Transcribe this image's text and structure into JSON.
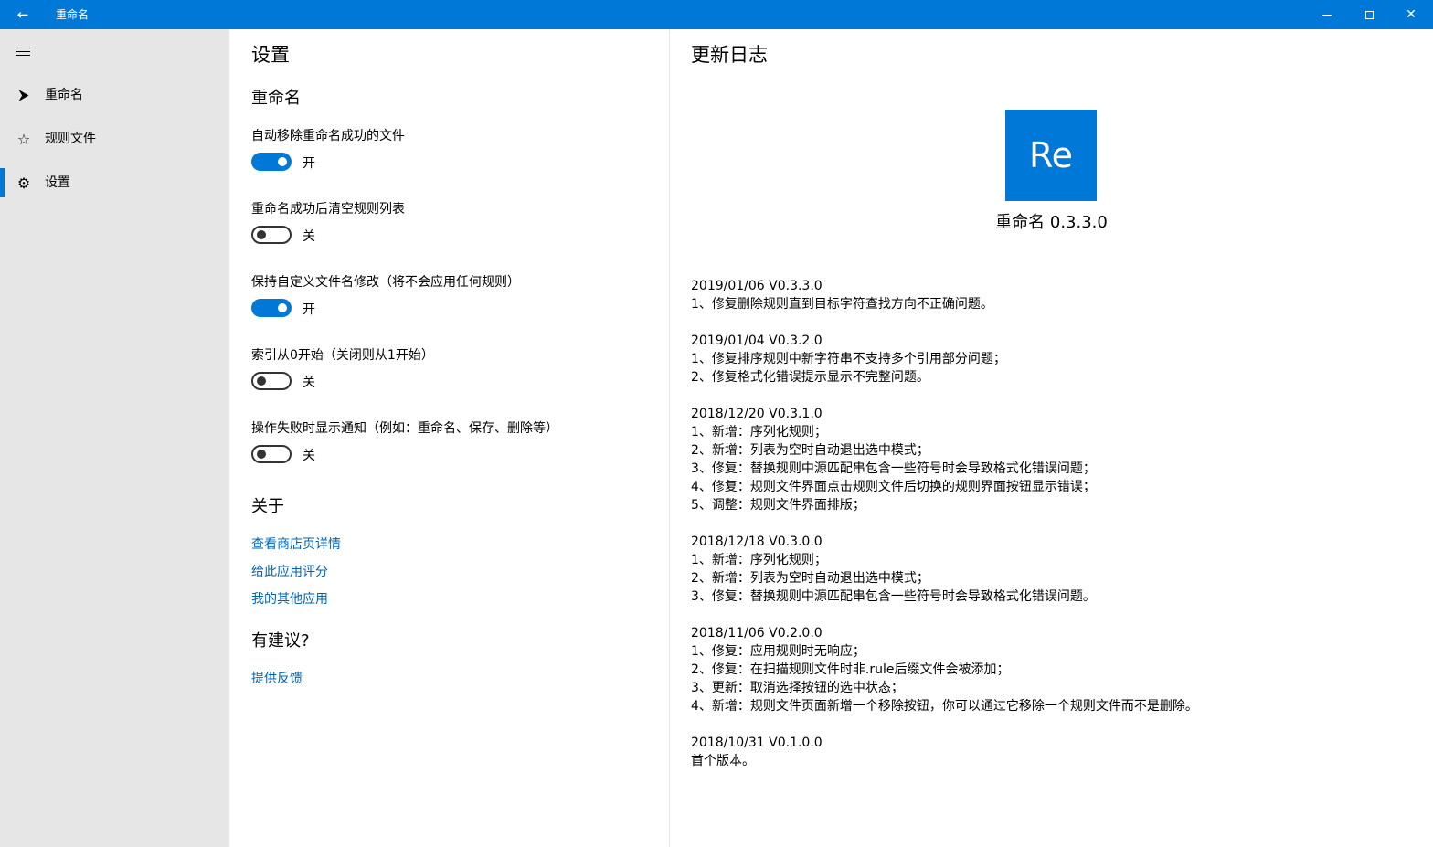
{
  "window": {
    "title": "重命名",
    "accent_color": "#0078d7"
  },
  "titlebar": {
    "back_icon": "back-arrow-icon",
    "back_glyph": "←",
    "close_glyph": "✕"
  },
  "sidebar": {
    "menu_icon": "hamburger-menu-icon",
    "items": [
      {
        "label": "重命名",
        "icon": "paper-plane-icon",
        "glyph": "⮞",
        "selected": false
      },
      {
        "label": "规则文件",
        "icon": "star-icon",
        "glyph": "☆",
        "selected": false
      },
      {
        "label": "设置",
        "icon": "gear-icon",
        "glyph": "⚙",
        "selected": true
      }
    ]
  },
  "settings": {
    "page_title": "设置",
    "section_rename": "重命名",
    "toggles": [
      {
        "label": "自动移除重命名成功的文件",
        "on": true,
        "state_text": "开"
      },
      {
        "label": "重命名成功后清空规则列表",
        "on": false,
        "state_text": "关"
      },
      {
        "label": "保持自定义文件名修改（将不会应用任何规则）",
        "on": true,
        "state_text": "开"
      },
      {
        "label": "索引从0开始（关闭则从1开始）",
        "on": false,
        "state_text": "关"
      },
      {
        "label": "操作失败时显示通知（例如：重命名、保存、删除等）",
        "on": false,
        "state_text": "关"
      }
    ],
    "section_about": "关于",
    "about_links": [
      "查看商店页详情",
      "给此应用评分",
      "我的其他应用"
    ],
    "section_feedback": "有建议?",
    "feedback_link": "提供反馈",
    "link_color": "#0063b1"
  },
  "changelog": {
    "title": "更新日志",
    "logo_text": "Re",
    "app_name": "重命名  0.3.3.0",
    "entries": [
      {
        "header": "2019/01/06  V0.3.3.0",
        "lines": [
          "1、修复删除规则直到目标字符查找方向不正确问题。"
        ]
      },
      {
        "header": "2019/01/04  V0.3.2.0",
        "lines": [
          "1、修复排序规则中新字符串不支持多个引用部分问题；",
          "2、修复格式化错误提示显示不完整问题。"
        ]
      },
      {
        "header": "2018/12/20  V0.3.1.0",
        "lines": [
          "1、新增：序列化规则；",
          "2、新增：列表为空时自动退出选中模式；",
          "3、修复：替换规则中源匹配串包含一些符号时会导致格式化错误问题；",
          "4、修复：规则文件界面点击规则文件后切换的规则界面按钮显示错误；",
          "5、调整：规则文件界面排版；"
        ]
      },
      {
        "header": "2018/12/18  V0.3.0.0",
        "lines": [
          "1、新增：序列化规则；",
          "2、新增：列表为空时自动退出选中模式；",
          "3、修复：替换规则中源匹配串包含一些符号时会导致格式化错误问题。"
        ]
      },
      {
        "header": "2018/11/06  V0.2.0.0",
        "lines": [
          "1、修复：应用规则时无响应；",
          "2、修复：在扫描规则文件时非.rule后缀文件会被添加；",
          "3、更新：取消选择按钮的选中状态；",
          "4、新增：规则文件页面新增一个移除按钮，你可以通过它移除一个规则文件而不是删除。"
        ]
      },
      {
        "header": "2018/10/31  V0.1.0.0",
        "lines": [
          "首个版本。"
        ]
      }
    ]
  }
}
